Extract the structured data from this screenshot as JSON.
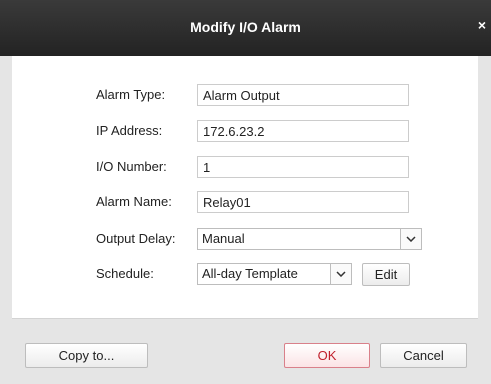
{
  "dialog": {
    "title": "Modify I/O Alarm",
    "close_glyph": "×"
  },
  "form": {
    "alarm_type_label": "Alarm Type:",
    "alarm_type_value": "Alarm Output",
    "ip_address_label": "IP Address:",
    "ip_address_value": "172.6.23.2",
    "io_number_label": "I/O Number:",
    "io_number_value": "1",
    "alarm_name_label": "Alarm Name:",
    "alarm_name_value": "Relay01",
    "output_delay_label": "Output Delay:",
    "output_delay_value": "Manual",
    "schedule_label": "Schedule:",
    "schedule_value": "All-day Template",
    "edit_label": "Edit"
  },
  "footer": {
    "copy_to_label": "Copy to...",
    "ok_label": "OK",
    "cancel_label": "Cancel"
  },
  "colors": {
    "titlebar": "#2d2d2d",
    "ok_accent": "#c0202c"
  },
  "icons": {
    "dropdown": "chevron-down-icon",
    "close": "close-icon"
  }
}
